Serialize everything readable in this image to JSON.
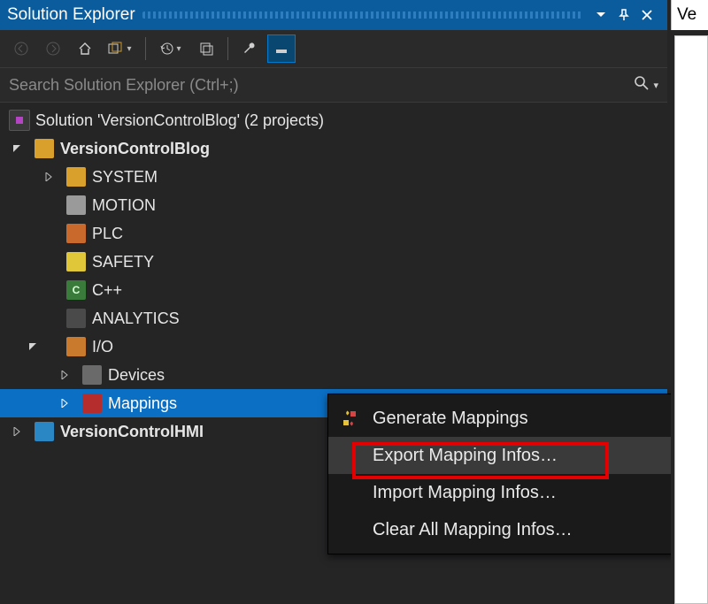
{
  "panel": {
    "title": "Solution Explorer"
  },
  "search": {
    "placeholder": "Search Solution Explorer (Ctrl+;)"
  },
  "solution": {
    "label": "Solution 'VersionControlBlog' (2 projects)",
    "projects": [
      {
        "label": "VersionControlBlog",
        "nodes": [
          {
            "label": "SYSTEM"
          },
          {
            "label": "MOTION"
          },
          {
            "label": "PLC"
          },
          {
            "label": "SAFETY"
          },
          {
            "label": "C++"
          },
          {
            "label": "ANALYTICS"
          },
          {
            "label": "I/O",
            "children": [
              {
                "label": "Devices"
              },
              {
                "label": "Mappings"
              }
            ]
          }
        ]
      },
      {
        "label": "VersionControlHMI"
      }
    ]
  },
  "contextmenu": {
    "items": [
      {
        "label": "Generate Mappings"
      },
      {
        "label": "Export Mapping Infos…"
      },
      {
        "label": "Import Mapping Infos…"
      },
      {
        "label": "Clear All Mapping Infos…"
      }
    ]
  },
  "rightpanel": {
    "tab_fragment": "Ve"
  }
}
